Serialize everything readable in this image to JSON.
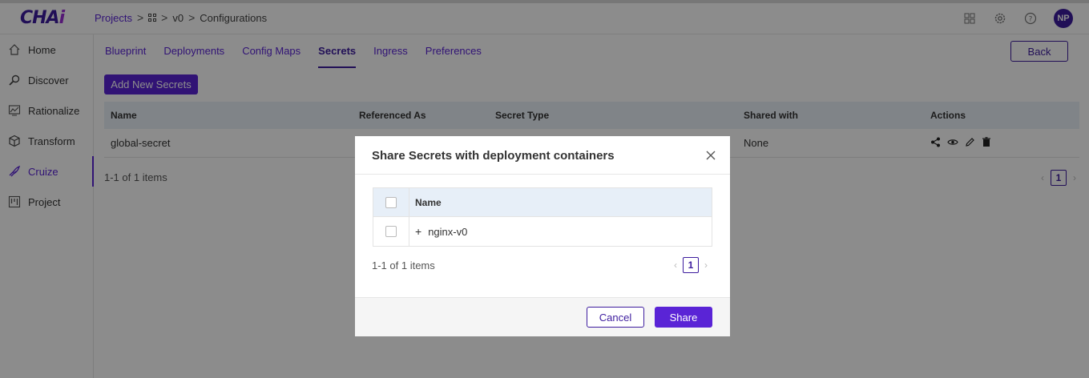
{
  "app": {
    "logo_main": "CHA",
    "logo_accent": "i"
  },
  "breadcrumb": {
    "projects": "Projects",
    "sep": ">",
    "version": "v0",
    "current": "Configurations"
  },
  "topbar": {
    "avatar_initials": "NP",
    "icons": [
      "apps-grid-icon",
      "settings-gear-icon",
      "help-icon"
    ]
  },
  "sidebar": {
    "items": [
      {
        "label": "Home",
        "icon": "home-icon"
      },
      {
        "label": "Discover",
        "icon": "discover-icon"
      },
      {
        "label": "Rationalize",
        "icon": "rationalize-icon"
      },
      {
        "label": "Transform",
        "icon": "transform-icon"
      },
      {
        "label": "Cruize",
        "icon": "cruize-icon"
      },
      {
        "label": "Project",
        "icon": "project-icon"
      }
    ],
    "active": "Cruize"
  },
  "tabs": {
    "items": [
      "Blueprint",
      "Deployments",
      "Config Maps",
      "Secrets",
      "Ingress",
      "Preferences"
    ],
    "active": "Secrets"
  },
  "actions": {
    "back_label": "Back",
    "add_label": "Add New Secrets"
  },
  "secrets_table": {
    "columns": [
      "Name",
      "Referenced As",
      "Secret Type",
      "Shared with",
      "Actions"
    ],
    "rows": [
      {
        "name": "global-secret",
        "referenced_as": "",
        "secret_type": "",
        "shared_with": "None"
      }
    ],
    "count": "1-1 of 1 items",
    "page": "1"
  },
  "modal": {
    "title": "Share Secrets with deployment containers",
    "column_name": "Name",
    "rows": [
      {
        "expand": "+",
        "name": "nginx-v0"
      }
    ],
    "count": "1-1 of 1 items",
    "page": "1",
    "cancel_label": "Cancel",
    "share_label": "Share"
  },
  "colors": {
    "primary": "#5a24d6",
    "primary_dark": "#3d1c9e",
    "table_header": "#eaf0f7"
  }
}
